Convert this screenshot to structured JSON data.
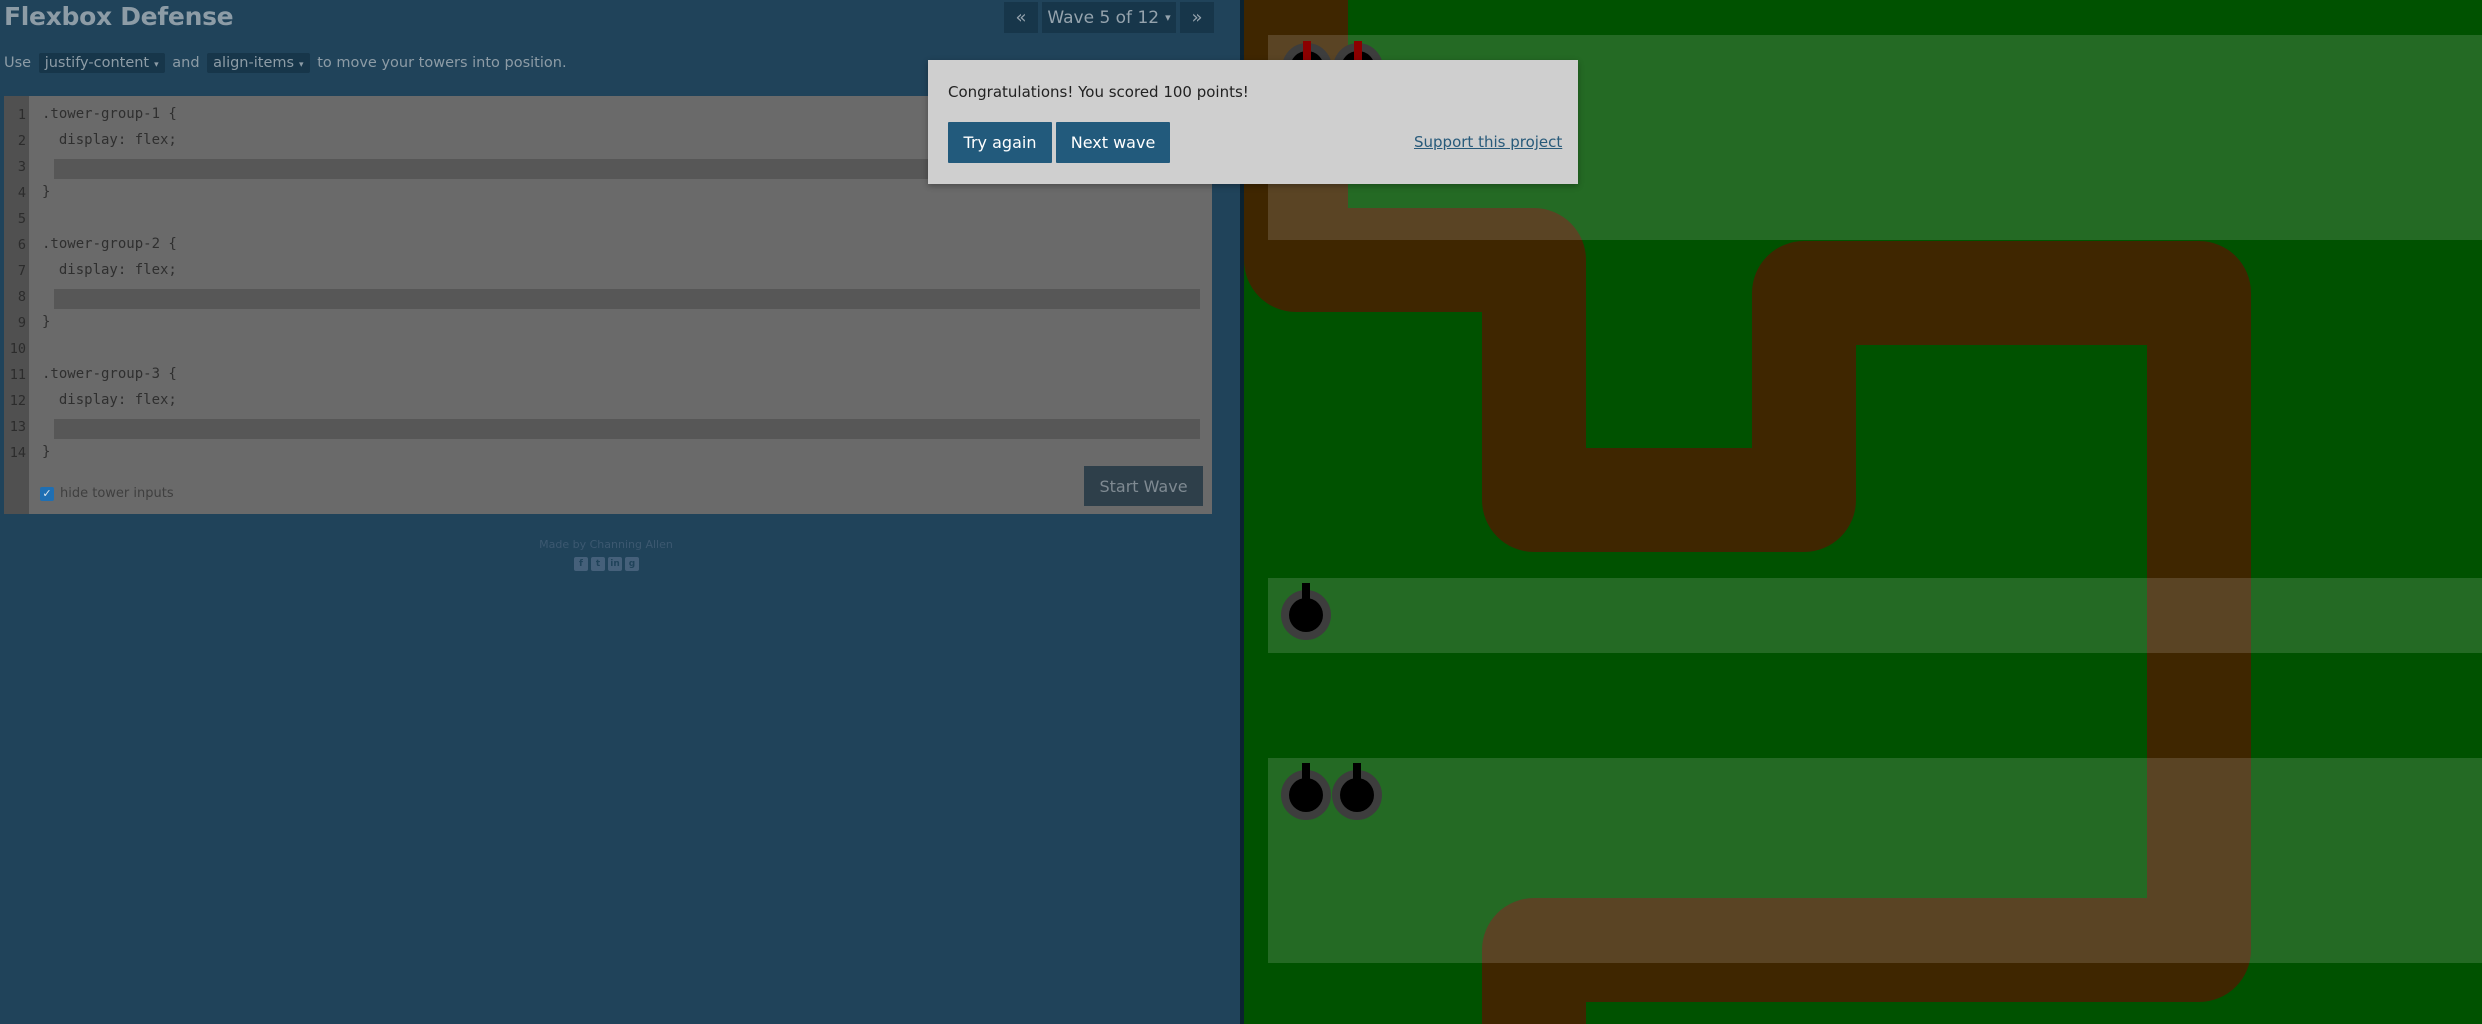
{
  "app": {
    "title": "Flexbox Defense"
  },
  "wave_nav": {
    "prev_glyph": "«",
    "next_glyph": "»",
    "wave_label": "Wave 5 of 12",
    "caret": "▾"
  },
  "instructions": {
    "prefix": "Use",
    "property_1": "justify-content",
    "conjunction": "and",
    "property_2": "align-items",
    "suffix": "to move your towers into position.",
    "caret": "▾"
  },
  "editor": {
    "line_numbers": [
      "1",
      "2",
      "3",
      "4",
      "5",
      "6",
      "7",
      "8",
      "9",
      "10",
      "11",
      "12",
      "13",
      "14"
    ],
    "lines": {
      "l1": ".tower-group-1 {",
      "l2": "  display: flex;",
      "l4": "}",
      "l6": ".tower-group-2 {",
      "l7": "  display: flex;",
      "l9": "}",
      "l11": ".tower-group-3 {",
      "l12": "  display: flex;",
      "l14": "}"
    },
    "start_wave_label": "Start Wave",
    "hide_inputs_label": "hide tower inputs",
    "hide_inputs_checked": true
  },
  "footer": {
    "credit": "Made by Channing Allen",
    "social_icons": [
      "facebook-icon",
      "twitter-icon",
      "linkedin-icon",
      "github-icon"
    ]
  },
  "modal": {
    "message": "Congratulations! You scored 100 points!",
    "try_again_label": "Try again",
    "next_wave_label": "Next wave",
    "support_label": "Support this project"
  },
  "board": {
    "colors": {
      "grass": "#005200",
      "path": "#3f2600",
      "tower": "#000000",
      "tower_ring": "#3d3d3d",
      "zone": "rgba(255,255,255,0.14)"
    },
    "tower_groups": [
      {
        "name": "tower-group-1",
        "towers": 2
      },
      {
        "name": "tower-group-2",
        "towers": 1
      },
      {
        "name": "tower-group-3",
        "towers": 2
      }
    ]
  }
}
